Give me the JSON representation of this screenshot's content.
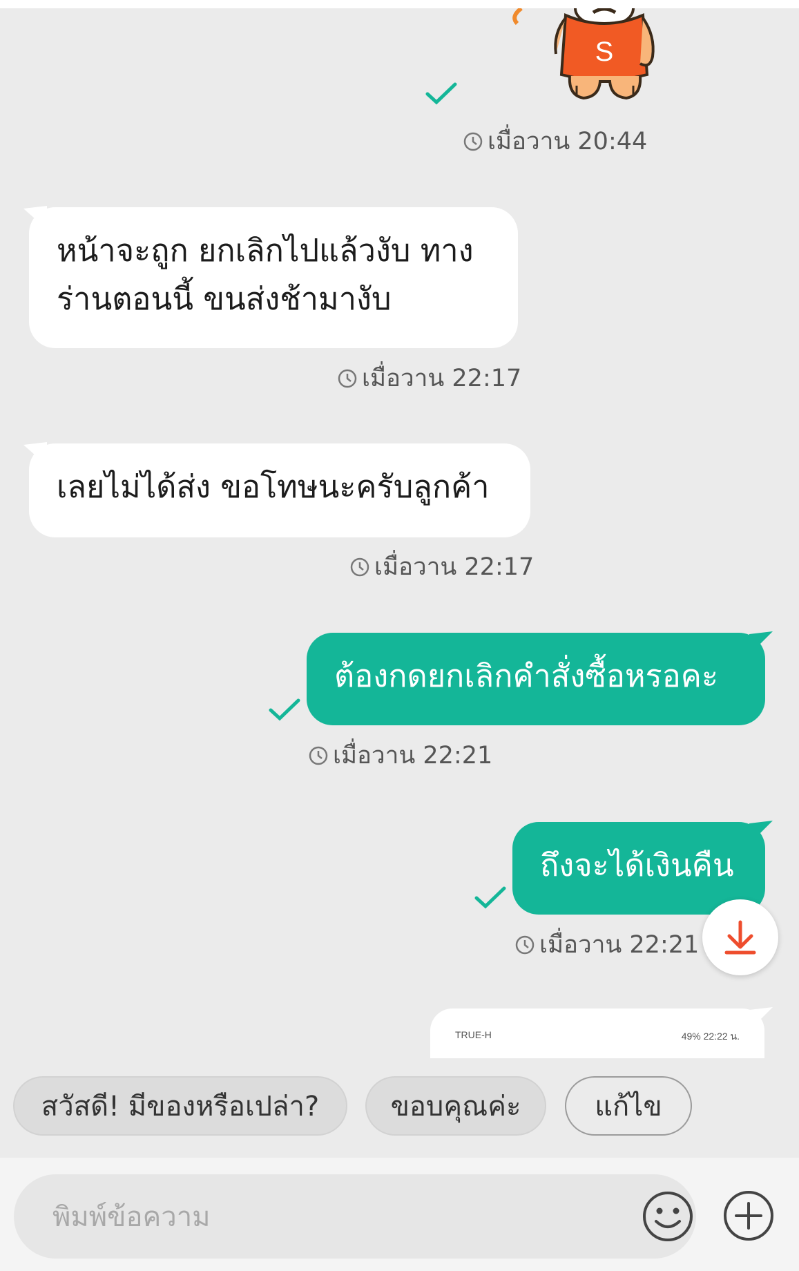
{
  "messages": [
    {
      "type": "sticker",
      "direction": "outgoing",
      "sticker_text": "S",
      "time": "เมื่อวาน 20:44",
      "status_icon": "check-icon"
    },
    {
      "direction": "incoming",
      "lines": [
        "หน้าจะถูก ยกเลิกไปแล้วงับ ทาง",
        "ร่านตอนนี้ ขนส่งช้ามางับ"
      ],
      "time": "เมื่อวาน 22:17"
    },
    {
      "direction": "incoming",
      "lines": [
        "เลยไม่ได้ส่ง ขอโทษนะครับลูกค้า"
      ],
      "time": "เมื่อวาน 22:17"
    },
    {
      "direction": "outgoing",
      "lines": [
        "ต้องกดยกเลิกคำสั่งซื้อหรอคะ"
      ],
      "time": "เมื่อวาน 22:21",
      "status_icon": "check-icon"
    },
    {
      "direction": "outgoing",
      "lines": [
        "ถึงจะได้เงินคืน"
      ],
      "time": "เมื่อวาน 22:21",
      "status_icon": "check-icon"
    },
    {
      "type": "image-preview",
      "direction": "outgoing",
      "status_left": "TRUE-H",
      "status_right": "49%  22:22 น."
    }
  ],
  "quick_replies": [
    "สวัสดี! มีของหรือเปล่า?",
    "ขอบคุณค่ะ",
    "แก้ไข"
  ],
  "composer": {
    "placeholder": "พิมพ์ข้อความ"
  },
  "icons": {
    "scroll": "download-arrow-icon",
    "emoji": "emoji-icon",
    "add": "plus-icon"
  },
  "colors": {
    "outgoing_bubble": "#14b698",
    "incoming_bubble": "#ffffff",
    "accent": "#ee4d2d",
    "background": "#ebebeb"
  }
}
